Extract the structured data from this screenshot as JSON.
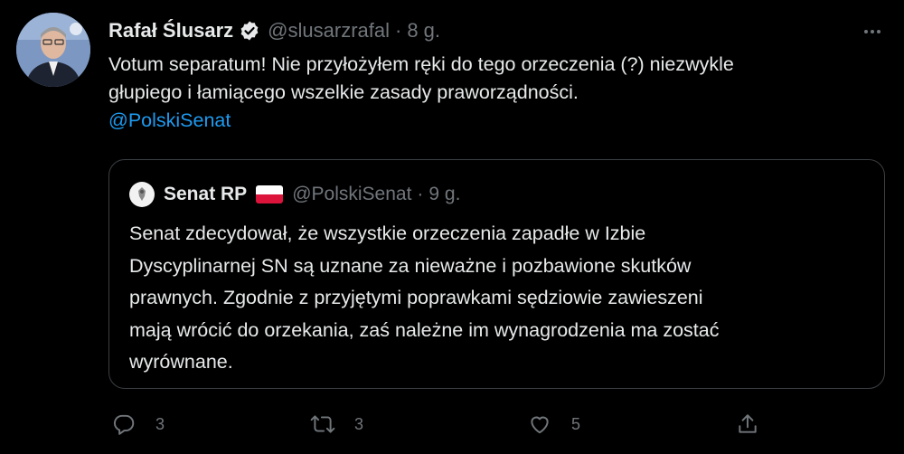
{
  "tweet": {
    "author_name": "Rafał Ślusarz",
    "author_handle": "@slusarzrafal",
    "separator": "·",
    "time": "8 g.",
    "text_line1": "Votum separatum! Nie przyłożyłem ręki do tego orzeczenia (?) niezwykle",
    "text_line2": "głupiego i łamiącego wszelkie zasady praworządności.",
    "mention": "@PolskiSenat"
  },
  "quoted": {
    "author_name": "Senat RP",
    "author_handle": "@PolskiSenat",
    "separator": "·",
    "time": "9 g.",
    "text_lines": [
      "Senat zdecydował, że wszystkie orzeczenia zapadłe w Izbie",
      "Dyscyplinarnej SN są uznane za nieważne i pozbawione skutków",
      "prawnych. Zgodnie z przyjętymi poprawkami sędziowie zawieszeni",
      "mają wrócić do orzekania, zaś należne im wynagrodzenia ma zostać",
      "wyrównane."
    ]
  },
  "actions": {
    "reply_count": "3",
    "retweet_count": "3",
    "like_count": "5"
  },
  "icons": {
    "verified": "verified-badge-icon",
    "more": "more-options-icon",
    "reply": "reply-icon",
    "retweet": "retweet-icon",
    "like": "heart-icon",
    "share": "share-icon",
    "flag": "poland-flag-icon"
  },
  "colors": {
    "background": "#000000",
    "text": "#e7e9ea",
    "muted": "#71767b",
    "link": "#1d9bf0",
    "border": "#3b3f43"
  }
}
